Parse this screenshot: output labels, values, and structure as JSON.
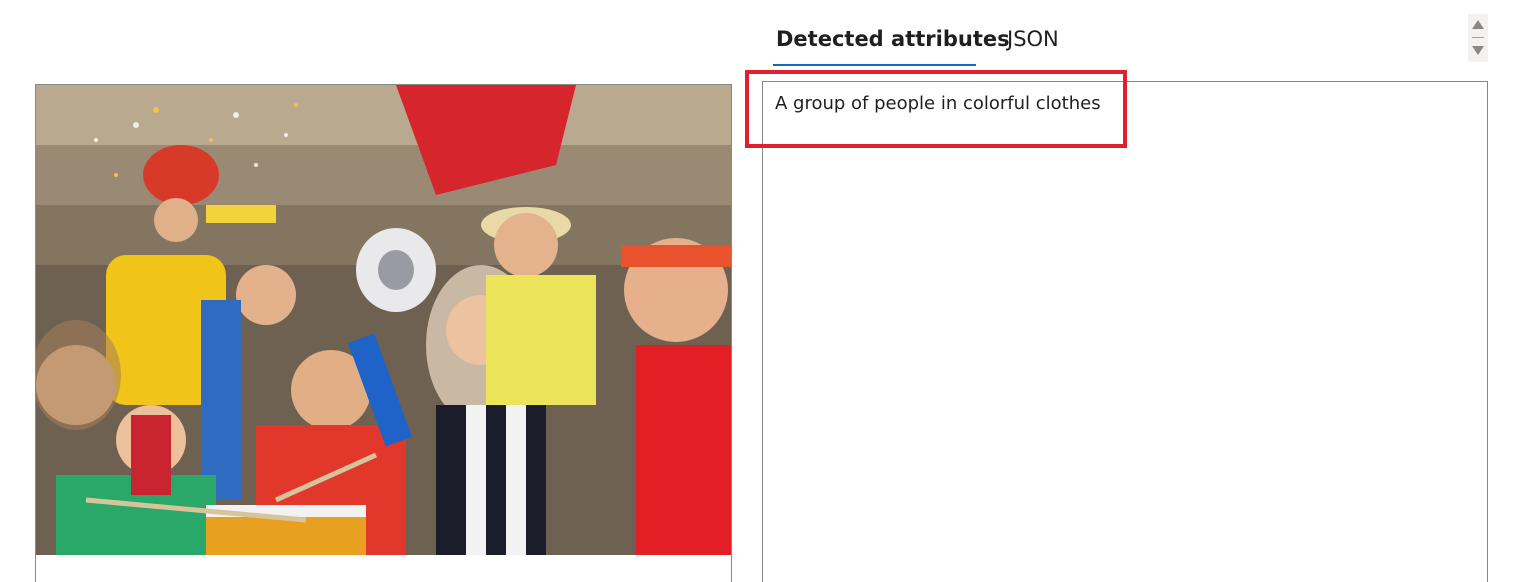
{
  "tabs": [
    {
      "label": "Detected attributes",
      "selected": true
    },
    {
      "label": "JSON",
      "selected": false
    }
  ],
  "result": {
    "caption": "A group of people in colorful clothes"
  },
  "image": {
    "description_icon": "photo-of-cheering-fans"
  },
  "colors": {
    "accent": "#0f6cbd",
    "highlight": "#e0202e",
    "border": "#8a8886"
  }
}
